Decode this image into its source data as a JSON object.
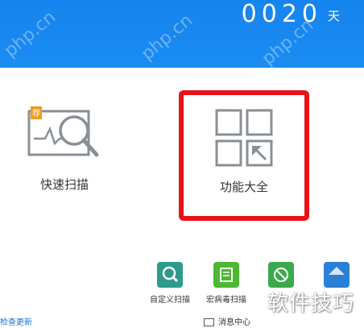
{
  "header": {
    "days_value": "0020",
    "days_unit": "天"
  },
  "tiles": {
    "quick_scan": "快速扫描",
    "all_features": "功能大全"
  },
  "tools": [
    {
      "label": "自定义扫描",
      "icon": "custom-scan-icon",
      "color": "#2d9a8c"
    },
    {
      "label": "宏病毒扫描",
      "icon": "macro-virus-scan-icon",
      "color": "#4cb832"
    },
    {
      "label": "",
      "icon": "shield-icon",
      "color": "#3aa94b"
    },
    {
      "label": "",
      "icon": "tool-icon",
      "color": "#2a7fd6"
    }
  ],
  "footer": {
    "check_update": "检查更新",
    "message_center": "消息中心",
    "watermark": "软件技巧",
    "site_watermark": "php.cn"
  },
  "colors": {
    "banner": "#1684ee",
    "highlight_border": "#e8111a",
    "badge": "#f39a1e"
  }
}
